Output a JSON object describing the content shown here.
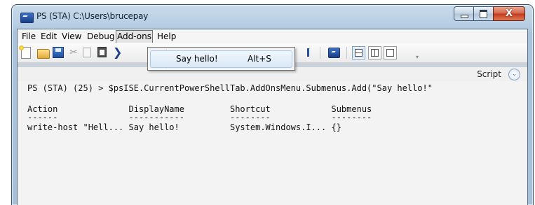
{
  "window": {
    "title": "PS (STA)  C:\\Users\\brucepay"
  },
  "caption": {
    "minimize_icon": "minimize-icon",
    "maximize_icon": "maximize-icon",
    "close_glyph": "X"
  },
  "menu": {
    "items": [
      "File",
      "Edit",
      "View",
      "Debug",
      "Add-ons",
      "Help"
    ],
    "active": "Add-ons"
  },
  "toolbar": {
    "icons": [
      "new-file-icon",
      "open-folder-icon",
      "save-icon",
      "cut-icon",
      "copy-icon",
      "paste-icon",
      "run-icon",
      "powershell-icon",
      "layout-top-icon",
      "layout-side-icon",
      "layout-max-icon"
    ]
  },
  "dropdown": {
    "items": [
      {
        "label": "Say hello!",
        "shortcut": "Alt+S"
      }
    ]
  },
  "script_pane": {
    "label": "Script",
    "toggle_glyph": "⌄"
  },
  "console": {
    "lines": [
      "PS (STA) (25) > $psISE.CurrentPowerShellTab.AddOnsMenu.Submenus.Add(\"Say hello!\"",
      "",
      "Action              DisplayName         Shortcut            Submenus",
      "------              -----------         --------            --------",
      "write-host \"Hell... Say hello!          System.Windows.I... {}"
    ]
  }
}
